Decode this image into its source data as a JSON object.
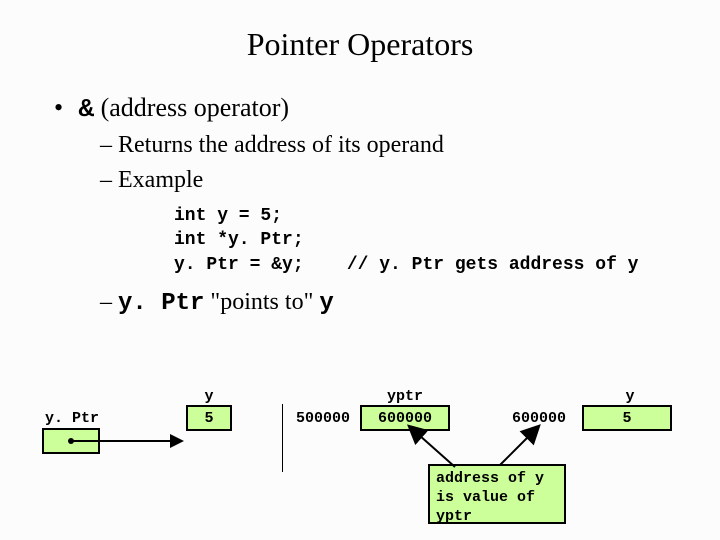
{
  "title": "Pointer Operators",
  "bullet": {
    "prefix": "•",
    "amp": "&",
    "rest": " (address operator)"
  },
  "sub": {
    "returns": "– Returns the address of its operand",
    "example": "– Example",
    "points_prefix": "– ",
    "points_ptr": "y. Ptr",
    "points_mid": " \"points to\" ",
    "points_y": "y"
  },
  "code": {
    "l1": "int y = 5;",
    "l2": "int *y. Ptr;",
    "l3": "y. Ptr = &y;    // y. Ptr gets address of y"
  },
  "diagram": {
    "left": {
      "yptr_label": "y. Ptr",
      "y_label": "y",
      "y_value": "5"
    },
    "right": {
      "yptr_label": "yptr",
      "yptr_value": "600000",
      "yptr_addr": "500000",
      "y_label": "y",
      "y_value": "5",
      "y_addr": "600000"
    },
    "note": {
      "l1": "address of y",
      "l2": "is value of",
      "l3": "yptr"
    }
  }
}
